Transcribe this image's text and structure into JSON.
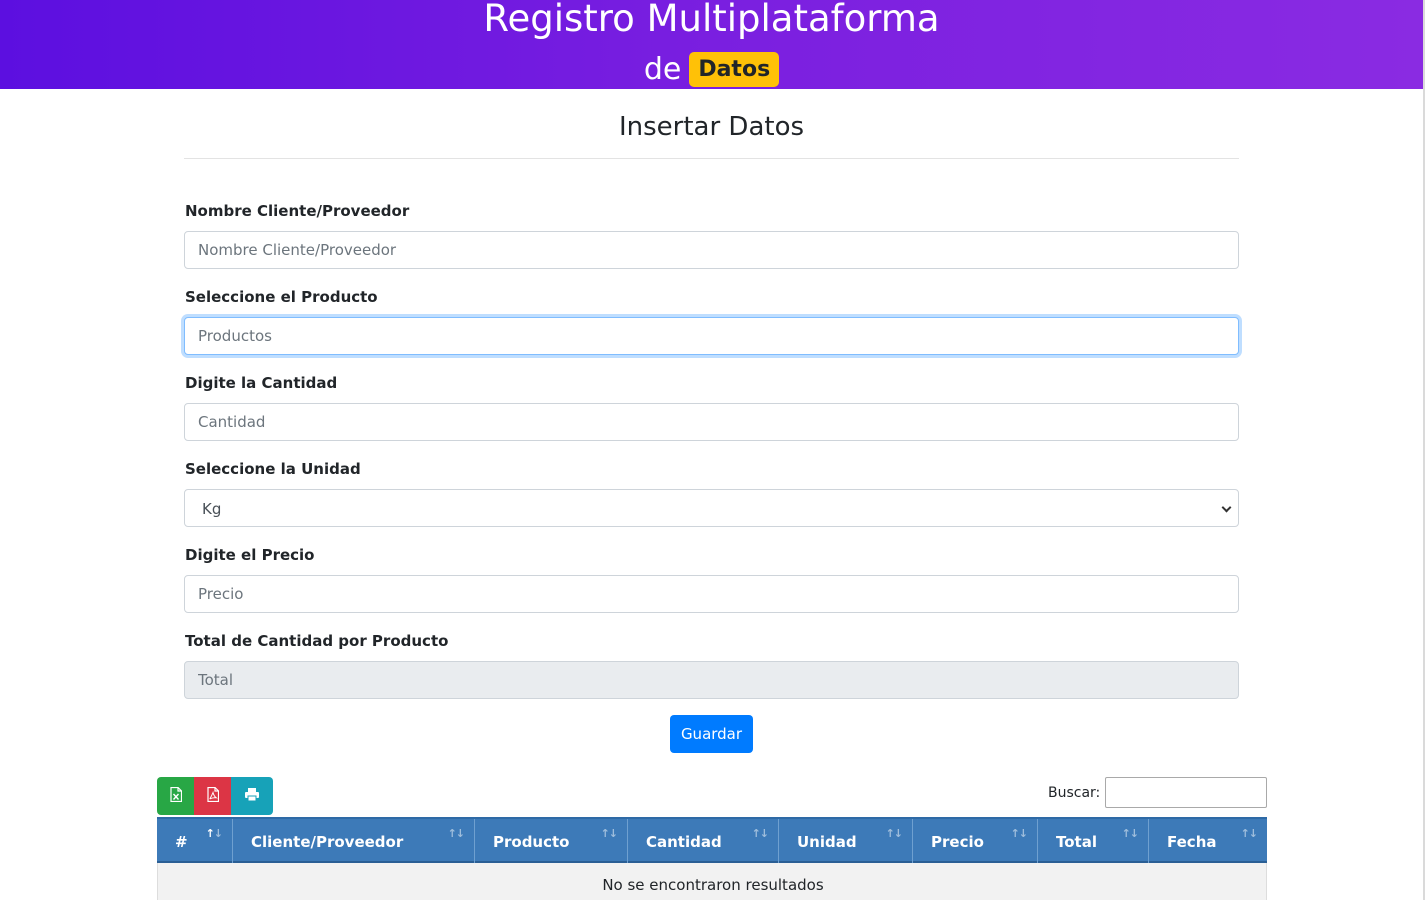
{
  "header": {
    "title": "Registro Multiplataforma",
    "sub_prefix": "de",
    "badge": "Datos"
  },
  "form": {
    "title": "Insertar Datos",
    "fields": [
      {
        "label": "Nombre Cliente/Proveedor",
        "placeholder": "Nombre Cliente/Proveedor",
        "value": ""
      },
      {
        "label": "Seleccione el Producto",
        "placeholder": "Productos",
        "value": "",
        "focused": true
      },
      {
        "label": "Digite la Cantidad",
        "placeholder": "Cantidad",
        "value": ""
      },
      {
        "label": "Seleccione la Unidad",
        "selected": "Kg"
      },
      {
        "label": "Digite el Precio",
        "placeholder": "Precio",
        "value": ""
      },
      {
        "label": "Total de Cantidad por Producto",
        "placeholder": "Total",
        "value": "",
        "readonly": true
      }
    ],
    "save_label": "Guardar"
  },
  "toolbar": {
    "export_buttons": [
      {
        "icon": "excel-file-icon",
        "color": "#28a745"
      },
      {
        "icon": "pdf-file-icon",
        "color": "#dc3545"
      },
      {
        "icon": "print-icon",
        "color": "#17a2b8"
      }
    ],
    "search_label": "Buscar:",
    "search_value": ""
  },
  "table": {
    "header_color": "#3d7ab8",
    "columns": [
      "#",
      "Cliente/Proveedor",
      "Producto",
      "Cantidad",
      "Unidad",
      "Precio",
      "Total",
      "Fecha"
    ],
    "sorted_column": "#",
    "empty_message": "No se encontraron resultados"
  }
}
